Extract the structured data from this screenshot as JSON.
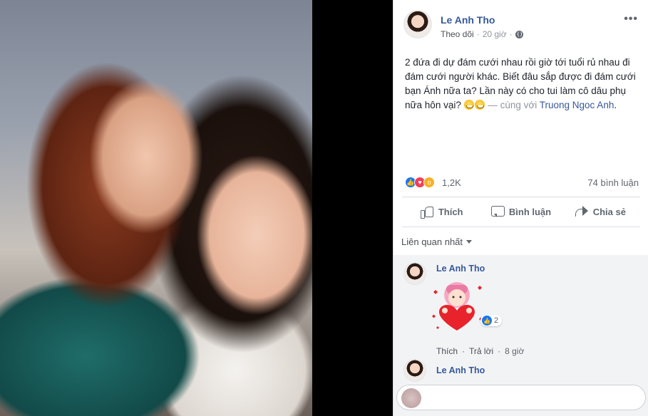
{
  "post": {
    "author": "Le Anh Tho",
    "follow_label": "Theo dõi",
    "time": "20 giờ",
    "privacy_icon": "globe-icon",
    "text_main": "2 đứa đi dự đám cưới nhau rồi giờ tới tuổi rủ nhau đi đám cưới người khác. Biết đâu sắp được đi đám cưới bạn Ánh nữa ta? Lần này có cho tui làm cô dâu phụ nữa hôn vại? ",
    "with_label": "— cùng với ",
    "tagged_person": "Truong Ngoc Anh",
    "text_end": ".",
    "reaction_count": "1,2K",
    "comment_count": "74 bình luận"
  },
  "actions": {
    "like_label": "Thích",
    "comment_label": "Bình luận",
    "share_label": "Chia sẻ"
  },
  "comments_section": {
    "sort_label": "Liên quan nhất",
    "comments": [
      {
        "author": "Le Anh Tho",
        "sticker": "heart-hug-sticker",
        "reaction_count": "2",
        "like_label": "Thích",
        "reply_label": "Trả lời",
        "time": "8 giờ"
      },
      {
        "author": "Le Anh Tho"
      }
    ],
    "reply_placeholder": ""
  },
  "colors": {
    "link": "#365899",
    "like_blue": "#1877f2",
    "love_red": "#f33e58",
    "wow_yellow": "#f7b125"
  }
}
